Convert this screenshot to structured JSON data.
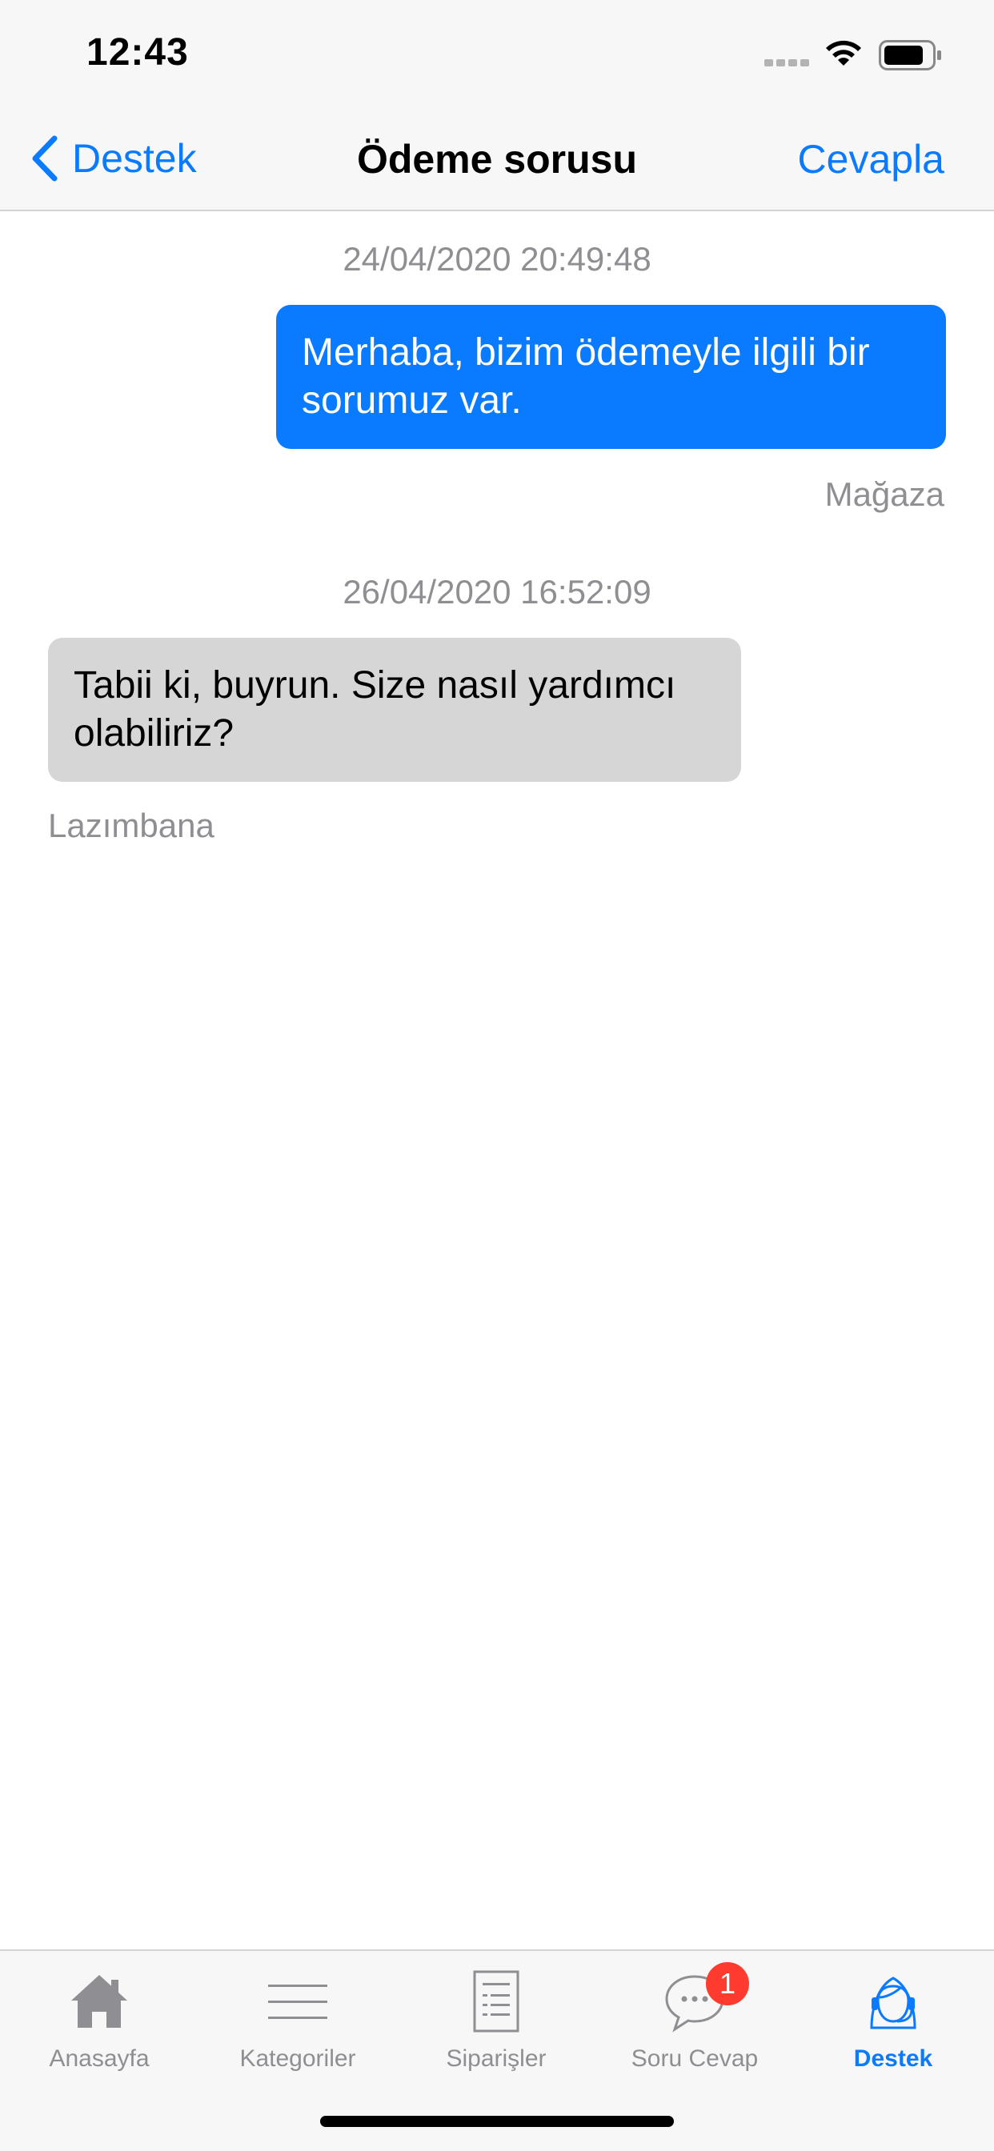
{
  "status_bar": {
    "time": "12:43"
  },
  "nav": {
    "back_label": "Destek",
    "title": "Ödeme sorusu",
    "action_label": "Cevapla"
  },
  "messages": [
    {
      "timestamp": "24/04/2020 20:49:48",
      "line1": "Merhaba, bizim ödemeyle ilgili bir",
      "line2": "sorumuz var.",
      "sender": "Mağaza",
      "direction": "outgoing"
    },
    {
      "timestamp": "26/04/2020 16:52:09",
      "line1": "Tabii ki, buyrun. Size nasıl yardımcı",
      "line2": "olabiliriz?",
      "sender": "Lazımbana",
      "direction": "incoming"
    }
  ],
  "tabs": [
    {
      "label": "Anasayfa",
      "icon": "home-icon"
    },
    {
      "label": "Kategoriler",
      "icon": "list-icon"
    },
    {
      "label": "Siparişler",
      "icon": "document-icon"
    },
    {
      "label": "Soru Cevap",
      "icon": "chat-bubble-icon",
      "badge": "1"
    },
    {
      "label": "Destek",
      "icon": "support-agent-icon",
      "active": true
    }
  ],
  "colors": {
    "accent": "#0a7aff",
    "incoming_bubble": "#d6d6d6",
    "badge": "#ff3b30"
  }
}
